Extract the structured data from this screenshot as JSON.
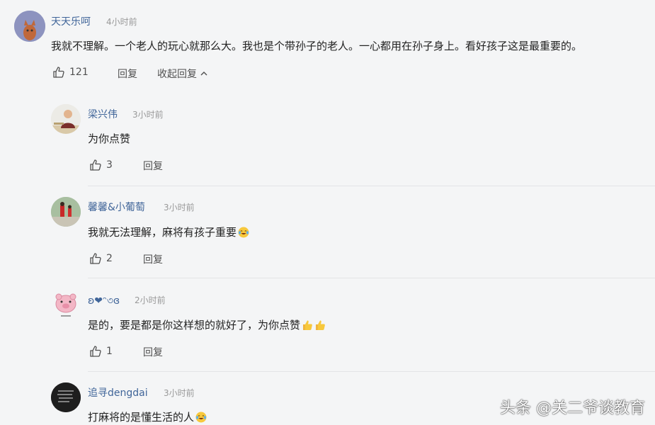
{
  "top_comment": {
    "username": "天天乐呵",
    "time": "4小时前",
    "content": "我就不理解。一个老人的玩心就那么大。我也是个带孙子的老人。一心都用在孙子身上。看好孩子这是最重要的。",
    "likes": "121",
    "reply_label": "回复",
    "collapse_label": "收起回复"
  },
  "replies": [
    {
      "username": "梁兴伟",
      "time": "3小时前",
      "content": "为你点赞",
      "likes": "3",
      "reply_label": "回复"
    },
    {
      "username": "馨馨&小葡萄",
      "time": "3小时前",
      "content": "我就无法理解，麻将有孩子重要",
      "likes": "2",
      "reply_label": "回复"
    },
    {
      "username": "ʚ❤ᵔ৩ɞ",
      "time": "2小时前",
      "content": "是的，要是都是你这样想的就好了，为你点赞",
      "likes": "1",
      "reply_label": "回复"
    },
    {
      "username": "追寻dengdai",
      "time": "3小时前",
      "content": "打麻将的是懂生活的人"
    }
  ],
  "watermark": "头条 @关二爷谈教育",
  "colors": {
    "background": "#f4f5f6",
    "username": "#406599",
    "time": "#999999",
    "text": "#222222"
  },
  "icons": [
    "thumbs-up-icon",
    "chevron-up-icon",
    "laughing-tears-emoji",
    "thumbs-up-emoji"
  ]
}
